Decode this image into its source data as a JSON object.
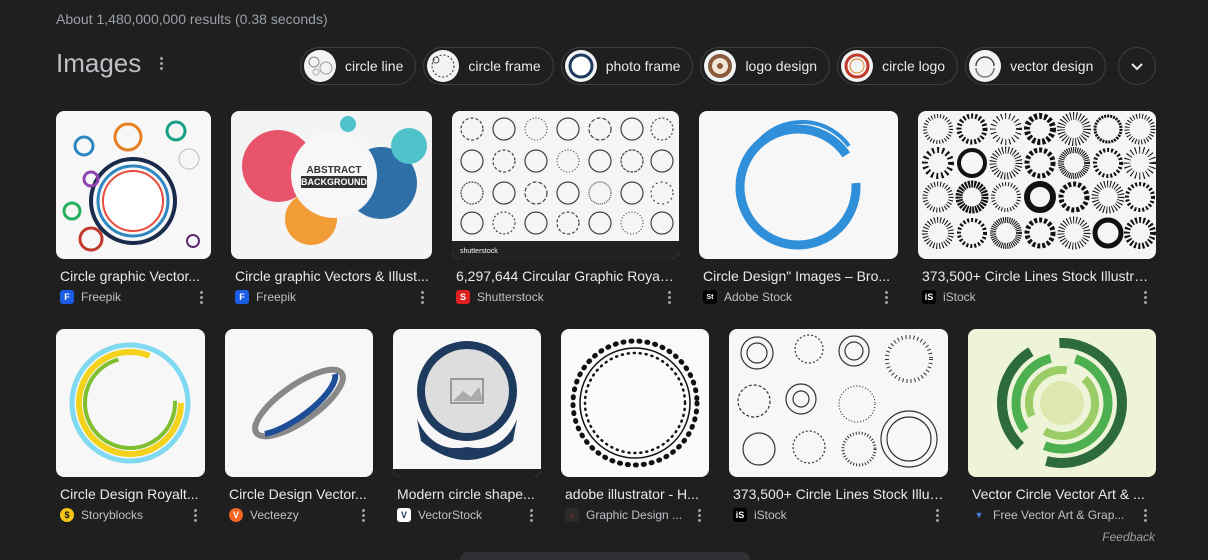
{
  "stats": "About 1,480,000,000 results (0.38 seconds)",
  "images_title": "Images",
  "chips": [
    {
      "label": "circle line",
      "icon": "circle-line-thumb"
    },
    {
      "label": "circle frame",
      "icon": "circle-frame-thumb"
    },
    {
      "label": "photo frame",
      "icon": "photo-frame-thumb"
    },
    {
      "label": "logo design",
      "icon": "logo-design-thumb"
    },
    {
      "label": "circle logo",
      "icon": "circle-logo-thumb"
    },
    {
      "label": "vector design",
      "icon": "vector-design-thumb"
    }
  ],
  "row1": [
    {
      "title": "Circle graphic Vector...",
      "source": "Freepik",
      "favicon": "F",
      "favicon_color": "#1c5de8"
    },
    {
      "title": "Circle graphic Vectors & Illust...",
      "source": "Freepik",
      "favicon": "F",
      "favicon_color": "#1c5de8",
      "badge_line1": "ABSTRACT",
      "badge_line2": "BACKGROUND"
    },
    {
      "title": "6,297,644 Circular Graphic Royalt...",
      "source": "Shutterstock",
      "favicon": "S",
      "favicon_color": "#e02020",
      "watermark": "shutterstock"
    },
    {
      "title": "Circle Design\" Images – Bro...",
      "source": "Adobe Stock",
      "favicon": "St",
      "favicon_color": "#000000"
    },
    {
      "title": "373,500+ Circle Lines Stock Illustra...",
      "source": "iStock",
      "favicon": "iS",
      "favicon_color": "#000000"
    }
  ],
  "row2": [
    {
      "title": "Circle Design Royalt...",
      "source": "Storyblocks",
      "favicon": "$",
      "favicon_color": "#f5c518"
    },
    {
      "title": "Circle Design Vector...",
      "source": "Vecteezy",
      "favicon": "V",
      "favicon_color": "#f26522"
    },
    {
      "title": "Modern circle shape...",
      "source": "VectorStock",
      "favicon": "V",
      "favicon_color": "#ffffff"
    },
    {
      "title": "adobe illustrator - H...",
      "source": "Graphic Design ...",
      "favicon": "○",
      "favicon_color": "#2b2b2b"
    },
    {
      "title": "373,500+ Circle Lines Stock Illus...",
      "source": "iStock",
      "favicon": "iS",
      "favicon_color": "#000000"
    },
    {
      "title": "Vector Circle Vector Art & ...",
      "source": "Free Vector Art & Grap...",
      "favicon": "▼",
      "favicon_color": "#1f1f1f"
    }
  ],
  "feedback": "Feedback",
  "colors": {
    "background": "#1f1f1f",
    "text": "#e8eaed",
    "muted": "#9aa0a6",
    "chip_border": "#3c4043"
  }
}
